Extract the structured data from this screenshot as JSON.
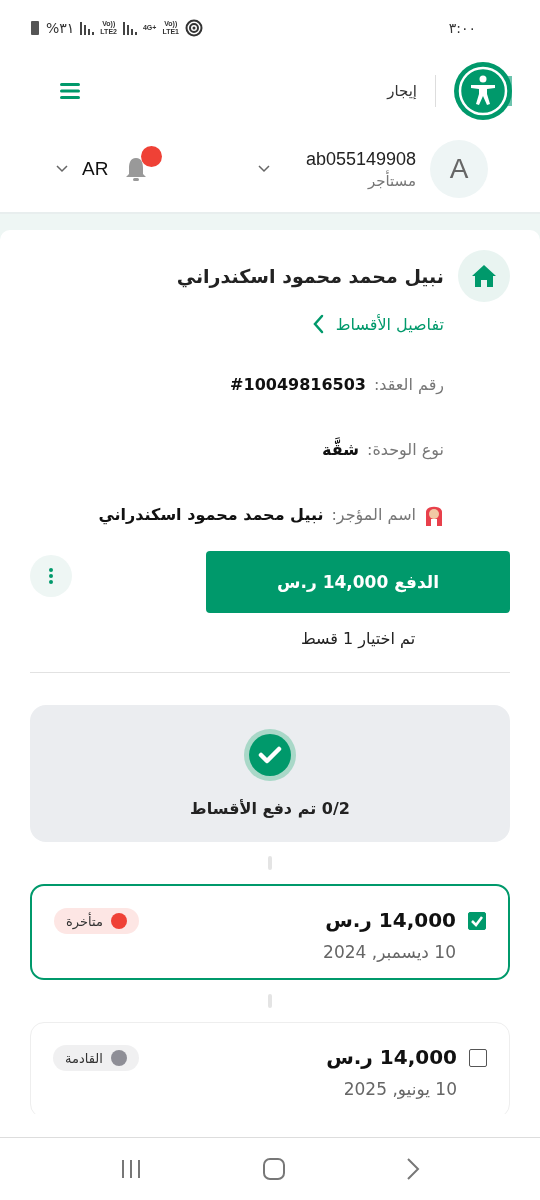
{
  "status_bar": {
    "time": "٣:٠٠",
    "battery": "%٣١",
    "networks": [
      {
        "top": "Vo))",
        "bottom": "LTE1"
      },
      {
        "top": "4G+"
      },
      {
        "top": "Vo))",
        "bottom": "LTE2"
      }
    ]
  },
  "header": {
    "brand": "إيجار"
  },
  "user": {
    "avatar_letter": "A",
    "username": "ab055149908",
    "role": "مستأجر",
    "language": "AR",
    "notification_badge": true
  },
  "property": {
    "title": "نبيل محمد محمود اسكندراني",
    "link": "تفاصيل الأقساط",
    "fields": [
      {
        "label": "رقم العقد:",
        "value": "#10049816503",
        "kind": "plain"
      },
      {
        "label": "نوع الوحدة:",
        "value": "شقَّة",
        "kind": "plain"
      },
      {
        "label": "اسم المؤجر:",
        "value": "نبيل محمد محمود اسكندراني",
        "kind": "person"
      }
    ]
  },
  "payment": {
    "button": "الدفع 14,000 ر.س",
    "selection_note": "تم اختيار 1 قسط"
  },
  "progress": {
    "summary": "0/2 تم دفع الأقساط"
  },
  "installments": [
    {
      "amount": "14,000 ر.س",
      "date": "10 ديسمبر, 2024",
      "status": "متأخرة",
      "color": "#ef4136",
      "checked": true
    },
    {
      "amount": "14,000 ر.س",
      "date": "10 يونيو, 2025",
      "status": "القادمة",
      "color": "#8e8e96",
      "checked": false
    }
  ]
}
